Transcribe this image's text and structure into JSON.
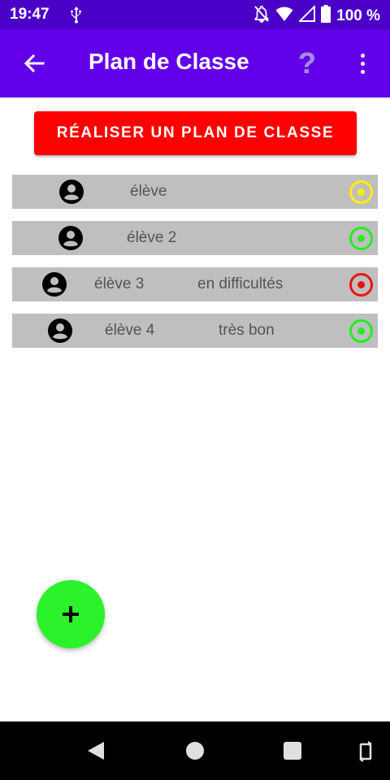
{
  "status_bar": {
    "time": "19:47",
    "battery_text": "100 %",
    "icons": [
      "usb-icon",
      "notifications-off-icon",
      "wifi-icon",
      "signal-icon",
      "battery-icon"
    ]
  },
  "app_bar": {
    "title": "Plan de Classe",
    "help_label": "?",
    "background": "#6200ea",
    "icons": [
      "back-arrow-icon",
      "help-icon",
      "more-vert-icon"
    ]
  },
  "main_button": {
    "label": "RÉALISER UN PLAN DE CLASSE",
    "color": "#ff0000"
  },
  "students": [
    {
      "name": "élève",
      "note": "",
      "status_color": "#ffee00"
    },
    {
      "name": "élève 2",
      "note": "",
      "status_color": "#22ee22"
    },
    {
      "name": "élève 3",
      "note": "en difficultés",
      "status_color": "#ee1111"
    },
    {
      "name": "élève 4",
      "note": "très bon",
      "status_color": "#22ee22"
    }
  ],
  "fab": {
    "label": "+",
    "color": "#2cf22c",
    "icon": "add-icon"
  },
  "nav_bar": {
    "icons": [
      "nav-back-icon",
      "nav-home-icon",
      "nav-recents-icon",
      "rotate-icon"
    ]
  }
}
